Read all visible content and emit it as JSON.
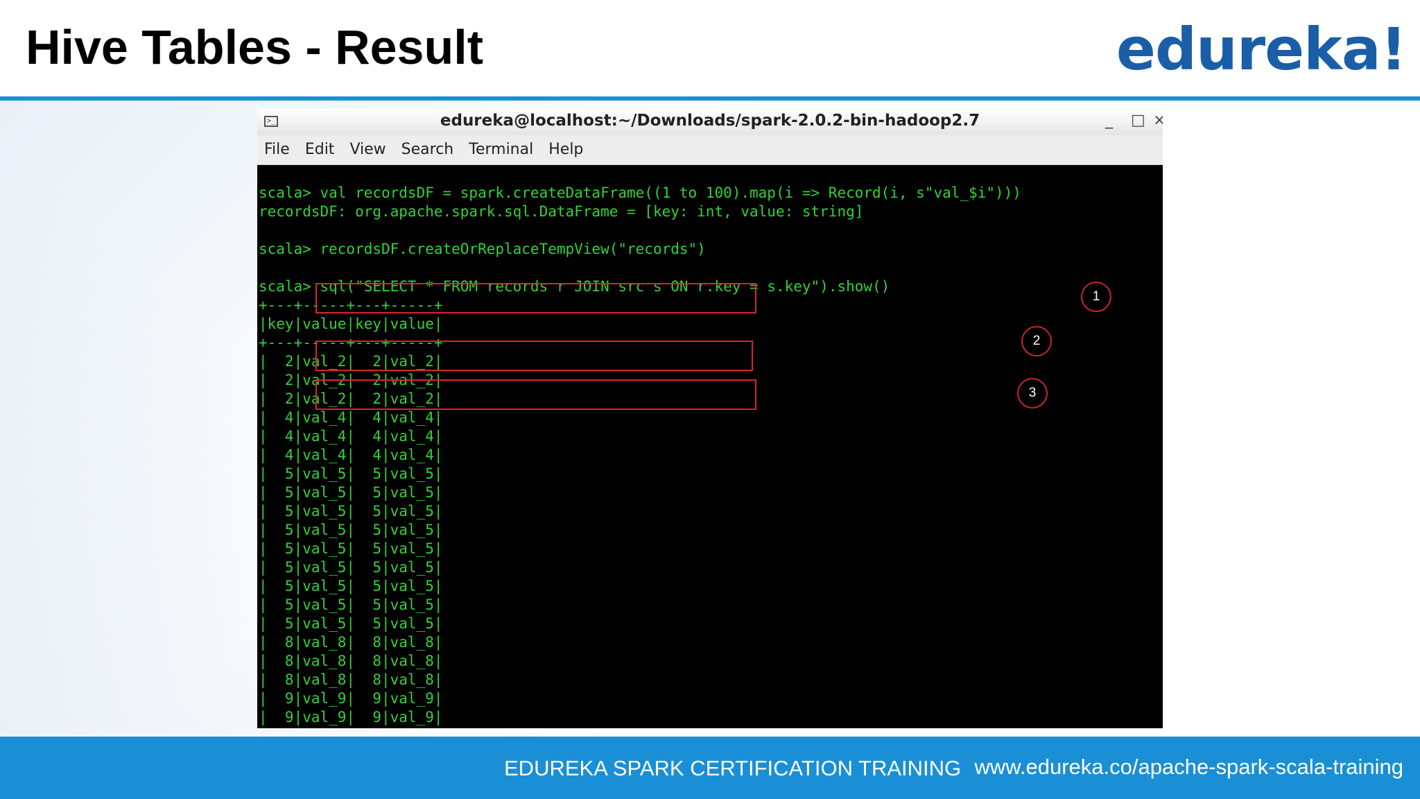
{
  "slide": {
    "title": "Hive Tables - Result",
    "logo": "edureka!"
  },
  "window": {
    "title": "edureka@localhost:~/Downloads/spark-2.0.2-bin-hadoop2.7",
    "icon": "terminal-icon",
    "minimize": "_",
    "maximize": "□",
    "close": "×"
  },
  "menu": [
    "File",
    "Edit",
    "View",
    "Search",
    "Terminal",
    "Help"
  ],
  "terminal": {
    "lines": [
      "",
      "scala> val recordsDF = spark.createDataFrame((1 to 100).map(i => Record(i, s\"val_$i\")))",
      "recordsDF: org.apache.spark.sql.DataFrame = [key: int, value: string]",
      "",
      "scala> recordsDF.createOrReplaceTempView(\"records\")",
      "",
      "scala> sql(\"SELECT * FROM records r JOIN src s ON r.key = s.key\").show()",
      "+---+-----+---+-----+",
      "|key|value|key|value|",
      "+---+-----+---+-----+",
      "|  2|val_2|  2|val_2|",
      "|  2|val_2|  2|val_2|",
      "|  2|val_2|  2|val_2|",
      "|  4|val_4|  4|val_4|",
      "|  4|val_4|  4|val_4|",
      "|  4|val_4|  4|val_4|",
      "|  5|val_5|  5|val_5|",
      "|  5|val_5|  5|val_5|",
      "|  5|val_5|  5|val_5|",
      "|  5|val_5|  5|val_5|",
      "|  5|val_5|  5|val_5|",
      "|  5|val_5|  5|val_5|",
      "|  5|val_5|  5|val_5|",
      "|  5|val_5|  5|val_5|",
      "|  5|val_5|  5|val_5|",
      "|  8|val_8|  8|val_8|",
      "|  8|val_8|  8|val_8|",
      "|  8|val_8|  8|val_8|",
      "|  9|val_9|  9|val_9|",
      "|  9|val_9|  9|val_9|"
    ],
    "callouts": [
      "1",
      "2",
      "3"
    ]
  },
  "footer": {
    "course": "EDUREKA SPARK CERTIFICATION TRAINING",
    "url": "www.edureka.co/apache-spark-scala-training"
  },
  "colors": {
    "accent": "#1a8fd6",
    "logo": "#1b5ea8",
    "terminal_text": "#34d238",
    "highlight": "#d9262c"
  }
}
